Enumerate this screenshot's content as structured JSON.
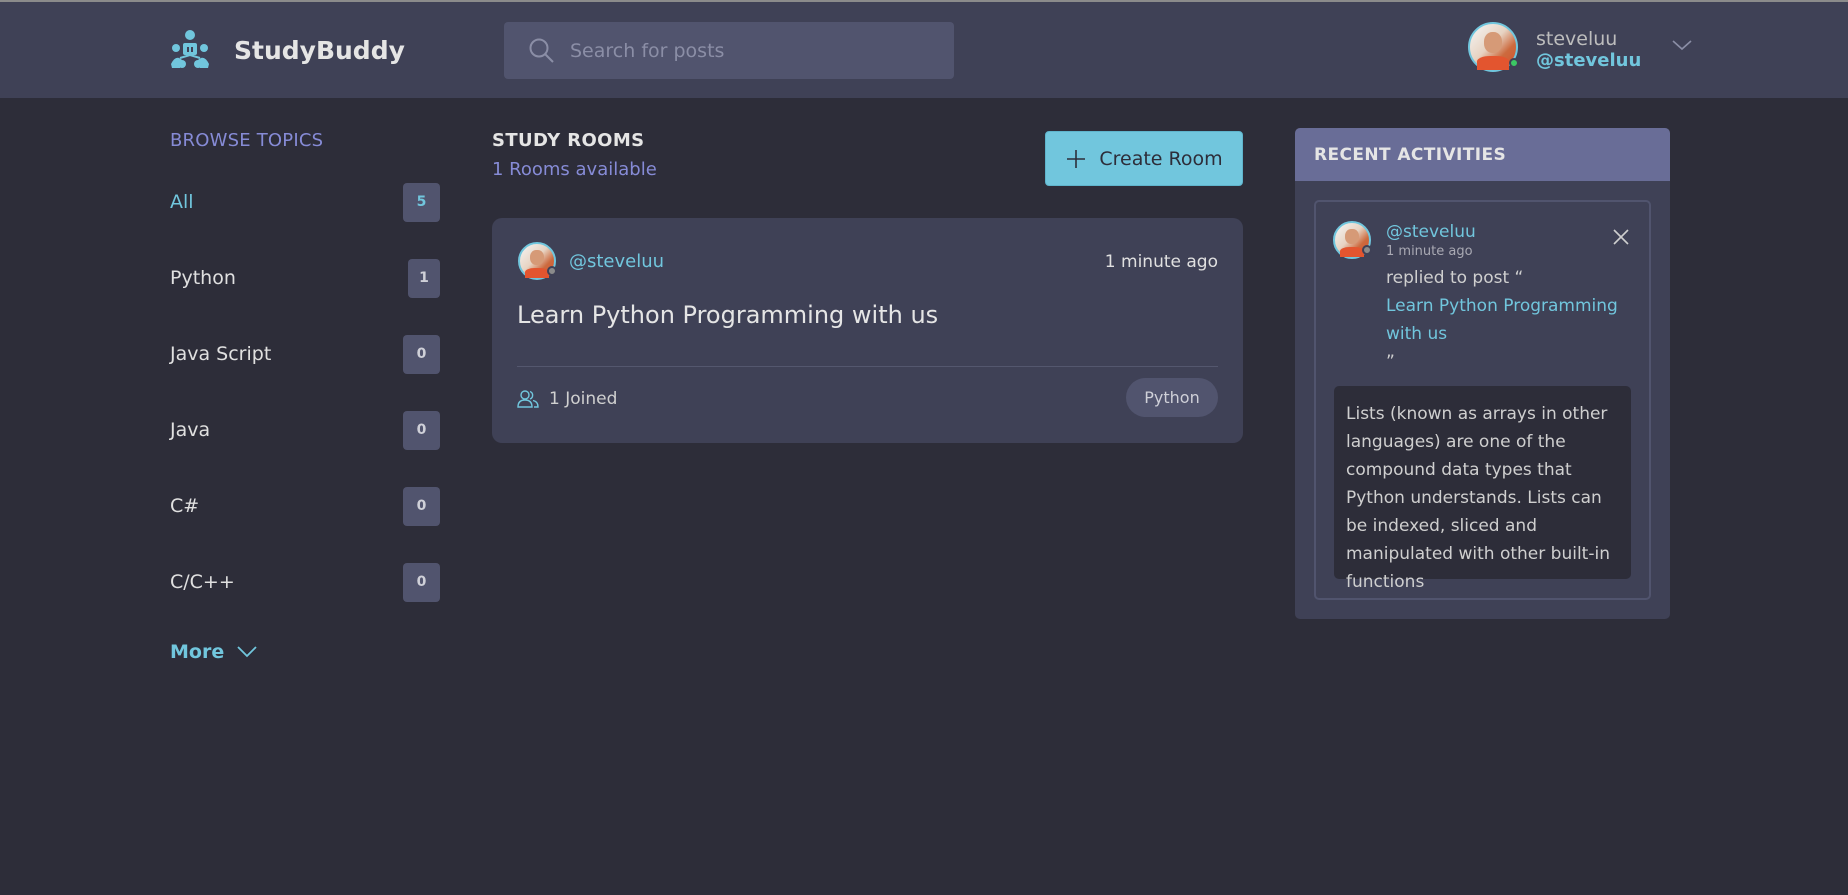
{
  "header": {
    "brand": "StudyBuddy",
    "search_placeholder": "Search for posts",
    "user": {
      "name": "steveluu",
      "handle": "@steveluu",
      "status": "online"
    }
  },
  "sidebar": {
    "title": "BROWSE TOPICS",
    "topics": [
      {
        "label": "All",
        "count": "5",
        "active": true
      },
      {
        "label": "Python",
        "count": "1"
      },
      {
        "label": "Java Script",
        "count": "0"
      },
      {
        "label": "Java",
        "count": "0"
      },
      {
        "label": "C#",
        "count": "0"
      },
      {
        "label": "C/C++",
        "count": "0"
      }
    ],
    "more_label": "More"
  },
  "main": {
    "title": "STUDY ROOMS",
    "subtitle": "1 Rooms available",
    "create_label": "Create Room",
    "rooms": [
      {
        "host": "@steveluu",
        "time": "1 minute ago",
        "title": "Learn Python Programming with us",
        "joined": "1 Joined",
        "topic": "Python"
      }
    ]
  },
  "activities": {
    "title": "RECENT ACTIVITIES",
    "items": [
      {
        "handle": "@steveluu",
        "time": "1 minute ago",
        "action": "replied to post “",
        "post_link": "Learn Python Programming with us",
        "close_quote": "”",
        "message": "Lists (known as arrays in other languages) are one of the compound data types that Python understands. Lists can be indexed, sliced and manipulated with other built-in functions"
      }
    ]
  },
  "colors": {
    "background": "#2d2d39",
    "panel": "#3f4156",
    "accent": "#71c6dd",
    "muted_accent": "#868bd6",
    "activity_header": "#696d97"
  }
}
